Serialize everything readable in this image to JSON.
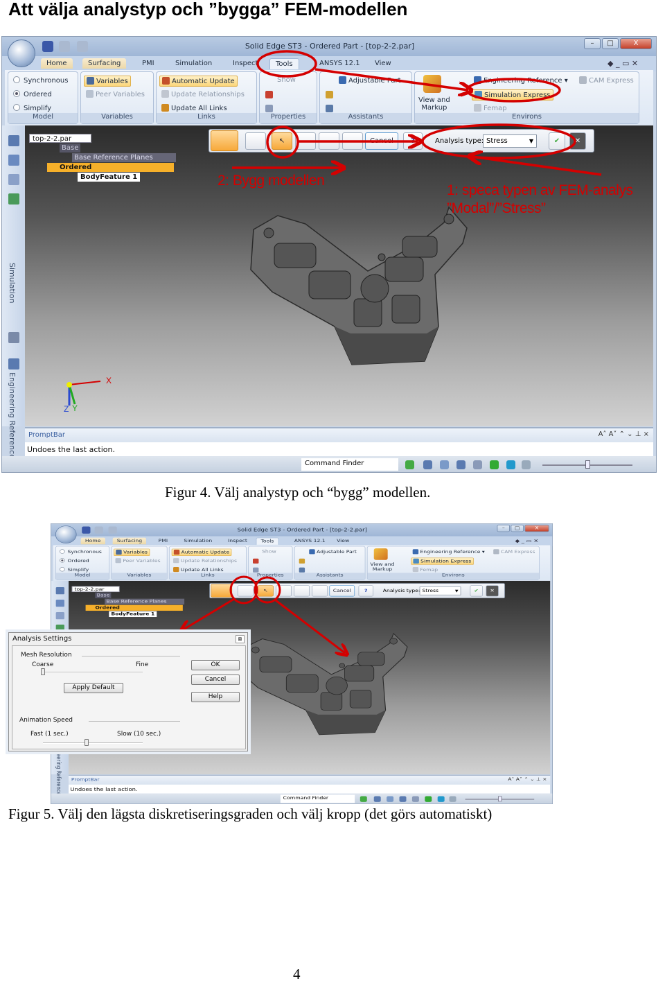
{
  "heading": "Att välja analystyp och ”bygga” FEM-modellen",
  "colors": {
    "annotation": "#d40000",
    "ribbon_highlight": "#fbd67a"
  },
  "app": {
    "title": "Solid Edge ST3 - Ordered Part - [top-2-2.par]",
    "window_controls": {
      "minimize": "–",
      "maximize": "□",
      "close": "X"
    },
    "tabs": [
      "Home",
      "Surfacing",
      "PMI",
      "Simulation",
      "Inspect",
      "Tools",
      "ANSYS 12.1",
      "View"
    ],
    "active_tab": "Tools",
    "ribbon": {
      "model": {
        "label": "Model",
        "items": [
          "Synchronous",
          "Ordered",
          "Simplify"
        ],
        "selected": "Ordered"
      },
      "variables": {
        "label": "Variables",
        "items": [
          "Variables",
          "Peer Variables"
        ]
      },
      "links": {
        "label": "Links",
        "items": [
          "Automatic Update",
          "Update Relationships",
          "Update All Links"
        ]
      },
      "properties": {
        "label": "Properties",
        "items": [
          "Show"
        ]
      },
      "assistants": {
        "label": "Assistants",
        "items": [
          "Adjustable Part"
        ]
      },
      "environs": {
        "label": "Environs",
        "view_markup": [
          "View and",
          "Markup"
        ],
        "items": [
          "Engineering Reference",
          "Simulation Express",
          "Femap",
          "CAM Express"
        ]
      }
    },
    "sidebar_tabs": [
      "Simulation",
      "Engineering Reference"
    ],
    "tree": [
      "top-2-2.par",
      "Base",
      "Base Reference Planes",
      "Ordered",
      "BodyFeature 1"
    ],
    "command_bar": {
      "cancel": "Cancel",
      "help": "?",
      "analysis_type_label": "Analysis type:",
      "analysis_type_value": "Stress"
    },
    "axes": {
      "x": "X",
      "y": "Y",
      "z": "Z"
    },
    "prompt_bar": {
      "title": "PromptBar",
      "message": "Undoes the last action.",
      "controls": "A˄ A˅ ⌃ ⌄ ⊥ ×"
    },
    "status_bar": {
      "command_finder": "Command Finder"
    }
  },
  "annotations": {
    "step2": "2: Bygg modellen",
    "step1_line1": "1: speca typen av FEM-analys",
    "step1_line2": "”Modal”/”Stress”"
  },
  "figure4_caption": "Figur 4. Välj analystyp och “bygg” modellen.",
  "dialog": {
    "title": "Analysis Settings",
    "close": "⊠",
    "mesh_resolution": "Mesh Resolution",
    "coarse": "Coarse",
    "fine": "Fine",
    "apply_default": "Apply Default",
    "animation_speed": "Animation Speed",
    "fast": "Fast (1 sec.)",
    "slow": "Slow (10 sec.)",
    "ok": "OK",
    "cancel": "Cancel",
    "help": "Help",
    "mesh_level": 0,
    "animation_level": 0.44
  },
  "figure5_caption": "Figur 5. Välj den lägsta diskretiseringsgraden och välj kropp (det görs automatiskt)",
  "page_number": "4"
}
